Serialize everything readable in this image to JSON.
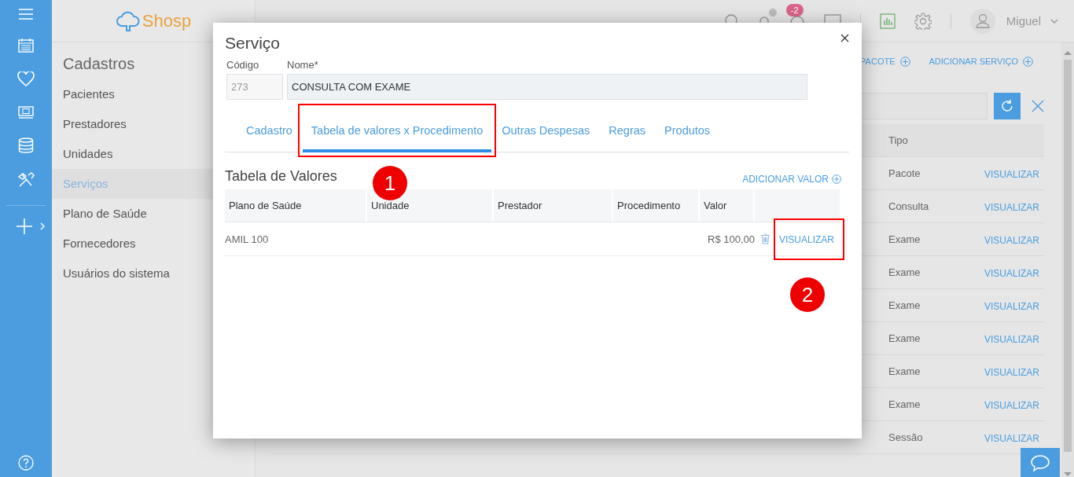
{
  "sidebar": {
    "logo": "Shosp",
    "title": "Cadastros",
    "items": [
      {
        "label": "Pacientes",
        "selected": false
      },
      {
        "label": "Prestadores",
        "selected": false
      },
      {
        "label": "Unidades",
        "selected": false
      },
      {
        "label": "Serviços",
        "selected": true
      },
      {
        "label": "Plano de Saúde",
        "selected": false
      },
      {
        "label": "Fornecedores",
        "selected": false
      },
      {
        "label": "Usuários do sistema",
        "selected": false
      }
    ]
  },
  "topbar": {
    "notification_badge": "-2",
    "user": "Miguel"
  },
  "main": {
    "actions": [
      "PACOTE",
      "ADICIONAR SERVIÇO"
    ],
    "table": {
      "columns": [
        "Tipo"
      ],
      "rows": [
        {
          "tipo": "Pacote",
          "action": "VISUALIZAR"
        },
        {
          "tipo": "Consulta",
          "action": "VISUALIZAR"
        },
        {
          "tipo": "Exame",
          "action": "VISUALIZAR"
        },
        {
          "tipo": "Exame",
          "action": "VISUALIZAR"
        },
        {
          "tipo": "Exame",
          "action": "VISUALIZAR"
        },
        {
          "tipo": "Exame",
          "action": "VISUALIZAR"
        },
        {
          "tipo": "Exame",
          "action": "VISUALIZAR"
        },
        {
          "tipo": "Exame",
          "action": "VISUALIZAR"
        },
        {
          "tipo": "Sessão",
          "action": "VISUALIZAR"
        }
      ]
    }
  },
  "modal": {
    "title": "Serviço",
    "fields": [
      {
        "label": "Código",
        "value": "273",
        "disabled": true
      },
      {
        "label": "Nome*",
        "value": "CONSULTA COM EXAME",
        "disabled": false
      }
    ],
    "tabs": [
      {
        "label": "Cadastro",
        "selected": false,
        "highlighted": false
      },
      {
        "label": "Tabela de valores x Procedimento",
        "selected": true,
        "highlighted": true
      },
      {
        "label": "Outras Despesas",
        "selected": false,
        "highlighted": false
      },
      {
        "label": "Regras",
        "selected": false,
        "highlighted": false
      },
      {
        "label": "Produtos",
        "selected": false,
        "highlighted": false
      }
    ],
    "section_title": "Tabela de Valores",
    "add_action": "ADICIONAR VALOR",
    "table": {
      "columns": [
        "Plano de Saúde",
        "Unidade",
        "Prestador",
        "Procedimento",
        "Valor"
      ],
      "rows": [
        {
          "plano": "AMIL 100",
          "valor": "R$ 100,00",
          "action": "VISUALIZAR",
          "highlighted": true
        }
      ]
    },
    "annotations": [
      {
        "label": "1"
      },
      {
        "label": "2"
      }
    ]
  }
}
